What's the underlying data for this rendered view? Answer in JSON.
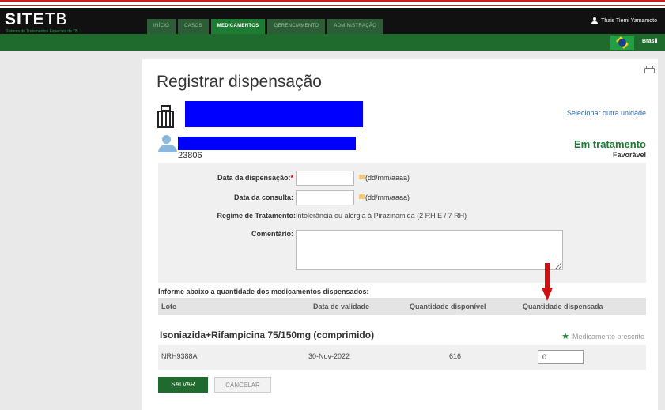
{
  "app": {
    "logo_site": "SITE",
    "logo_tb": "TB",
    "logo_subtitle": "Sistema de Tratamentos Especiais de TB"
  },
  "nav": {
    "tabs": [
      {
        "label": "INÍCIO"
      },
      {
        "label": "CASOS"
      },
      {
        "label": "MEDICAMENTOS",
        "active": true
      },
      {
        "label": "GERENCIAMENTO"
      },
      {
        "label": "ADMINISTRAÇÃO"
      }
    ]
  },
  "user": {
    "name": "Thais Tiemi Yamamoto"
  },
  "locale": {
    "country": "Brasil"
  },
  "page": {
    "title": "Registrar dispensação",
    "select_unit_link": "Selecionar outra unidade",
    "patient_id": "23806",
    "status": "Em tratamento",
    "status_detail": "Favorável"
  },
  "form": {
    "dispensation_date_label": "Data da dispensação:",
    "required_mark": "*",
    "date_hint": "(dd/mm/aaaa)",
    "consult_date_label": "Data da consulta:",
    "regimen_label": "Regime de Tratamento:",
    "regimen_value": "Intolerância ou alergia à Pirazinamida (2 RH E / 7 RH)",
    "comment_label": "Comentário:"
  },
  "table": {
    "instruction": "Informe abaixo a quantidade dos medicamentos dispensados:",
    "headers": [
      "Lote",
      "Data de validade",
      "Quantidade disponível",
      "Quantidade dispensada"
    ],
    "drug_name": "Isoniazida+Rifampicina 75/150mg (comprimido)",
    "prescribed_label": "Medicamento prescrito",
    "rows": [
      {
        "lote": "NRH9388A",
        "validade": "30-Nov-2022",
        "disponivel": "616",
        "dispensada": "0"
      }
    ]
  },
  "buttons": {
    "save": "SALVAR",
    "cancel": "CANCELAR"
  },
  "colors": {
    "header_bg": "#111111",
    "nav_active": "#1e7b33",
    "green_bar": "#1f6b2d",
    "status_green": "#1f7a35",
    "link_blue": "#2a6ba8",
    "annotation_red": "#d01010",
    "redaction_blue": "#0000ff"
  }
}
